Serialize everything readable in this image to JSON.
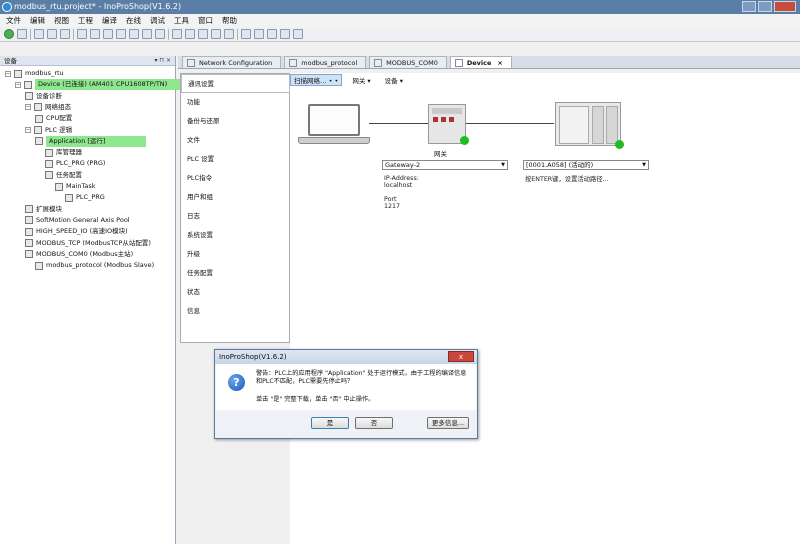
{
  "window": {
    "title": "modbus_rtu.project* - InoProShop(V1.6.2)"
  },
  "menu": [
    "文件",
    "编辑",
    "视图",
    "工程",
    "编译",
    "在线",
    "调试",
    "工具",
    "窗口",
    "帮助"
  ],
  "left_pane": {
    "title": "设备",
    "pin_controls": "▾ ⊓ ×",
    "tree": [
      {
        "label": "modbus_rtu",
        "level": 0,
        "icon": "project-icon",
        "hl": false
      },
      {
        "label": "Device (已连接) (AM401 CPU1608TP/TN)",
        "level": 1,
        "icon": "device-icon",
        "hl": true
      },
      {
        "label": "设备诊断",
        "level": 2,
        "icon": "diagnostic-icon",
        "hl": false
      },
      {
        "label": "网络组态",
        "level": 2,
        "icon": "network-icon",
        "hl": false
      },
      {
        "label": "CPU配置",
        "level": 3,
        "icon": "cpu-icon",
        "hl": false
      },
      {
        "label": "PLC 逻辑",
        "level": 2,
        "icon": "plc-logic-icon",
        "hl": false
      },
      {
        "label": "Application [运行]",
        "level": 3,
        "icon": "application-icon",
        "hl": true
      },
      {
        "label": "库管理器",
        "level": 4,
        "icon": "library-icon",
        "hl": false
      },
      {
        "label": "PLC_PRG (PRG)",
        "level": 4,
        "icon": "pou-icon",
        "hl": false
      },
      {
        "label": "任务配置",
        "level": 4,
        "icon": "task-config-icon",
        "hl": false
      },
      {
        "label": "MainTask",
        "level": 5,
        "icon": "task-icon",
        "hl": false
      },
      {
        "label": "PLC_PRG",
        "level": 6,
        "icon": "pou-call-icon",
        "hl": false
      },
      {
        "label": "扩展模块",
        "level": 2,
        "icon": "module-icon",
        "hl": false
      },
      {
        "label": "SoftMotion General Axis Pool",
        "level": 2,
        "icon": "axis-pool-icon",
        "hl": false
      },
      {
        "label": "HIGH_SPEED_IO (高速IO模块)",
        "level": 2,
        "icon": "io-icon",
        "hl": false
      },
      {
        "label": "MODBUS_TCP (ModbusTCP从站配置)",
        "level": 2,
        "icon": "modbus-tcp-icon",
        "hl": false
      },
      {
        "label": "MODBUS_COM0 (Modbus主站)",
        "level": 2,
        "icon": "modbus-com-icon",
        "hl": false
      },
      {
        "label": "modbus_protocol (Modbus Slave)",
        "level": 3,
        "icon": "slave-icon",
        "hl": false
      }
    ]
  },
  "tabs": [
    {
      "label": "Network Configuration",
      "active": false
    },
    {
      "label": "modbus_protocol",
      "active": false
    },
    {
      "label": "MODBUS_COM0",
      "active": false
    },
    {
      "label": "Device",
      "active": true
    }
  ],
  "device_nav": [
    "通讯设置",
    "功能",
    "备份与还原",
    "文件",
    "PLC 设置",
    "PLC指令",
    "用户和组",
    "日志",
    "系统设置",
    "升级",
    "任务配置",
    "状态",
    "信息"
  ],
  "scan": {
    "network": "扫描网络…",
    "sep": "• •",
    "gateway": "网关 ▾",
    "device": "设备 ▾"
  },
  "gateway": {
    "label": "网关",
    "select": "Gateway-2",
    "ip_label": "IP-Address:",
    "ip_value": "localhost",
    "port_label": "Port",
    "port_value": "1217"
  },
  "device_select": {
    "select": "[0001.A058] (活动的)",
    "hint": "按ENTER键，设置活动路径…"
  },
  "dialog": {
    "title": "InoProShop(V1.6.2)",
    "close": "x",
    "message": "警告：PLC上的应用程序 \"Application\" 处于运行模式，由于工程的编译信息和PLC不匹配，PLC需要先停止吗？",
    "prompt": "单击 \"是\" 完整下载，单击 \"否\" 中止操作。",
    "buttons": {
      "yes": "是",
      "no": "否",
      "details": "更多信息..."
    }
  },
  "colors": {
    "highlight": "#8ee68e",
    "status_ok": "#22bb22",
    "titlebar": "#5a7ea6"
  }
}
